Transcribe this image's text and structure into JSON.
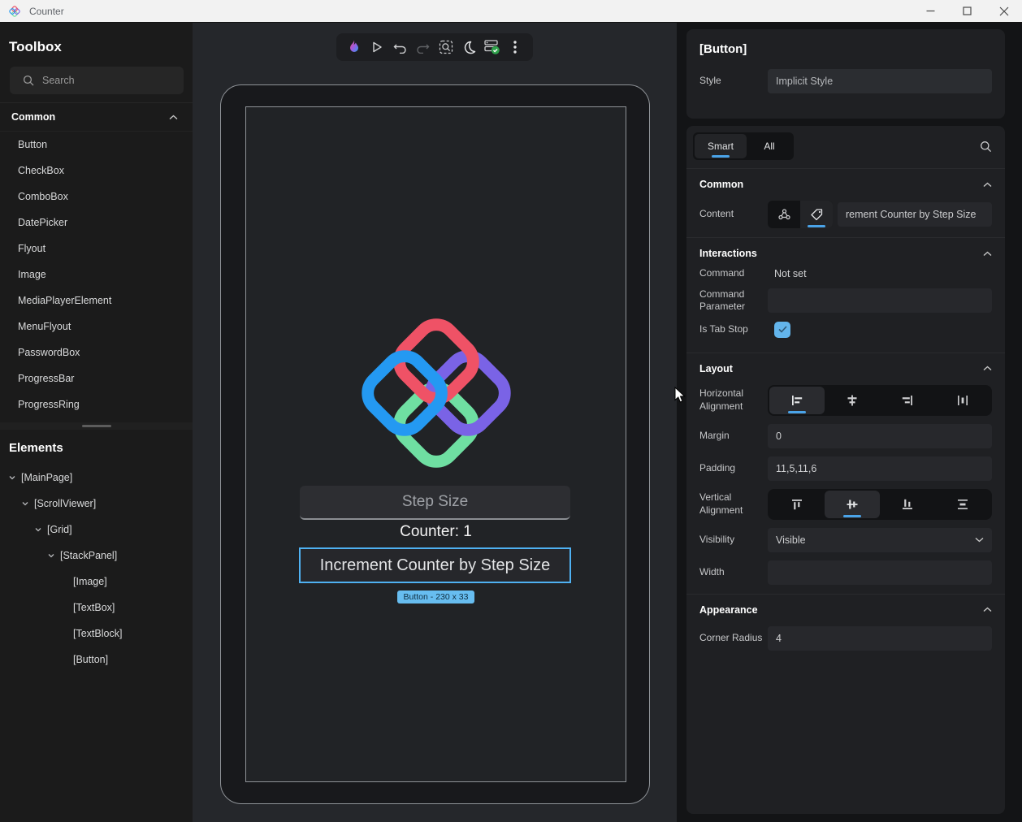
{
  "titlebar": {
    "title": "Counter"
  },
  "toolbox": {
    "title": "Toolbox",
    "search_placeholder": "Search",
    "section_label": "Common",
    "items": [
      "Button",
      "CheckBox",
      "ComboBox",
      "DatePicker",
      "Flyout",
      "Image",
      "MediaPlayerElement",
      "MenuFlyout",
      "PasswordBox",
      "ProgressBar",
      "ProgressRing"
    ]
  },
  "elements": {
    "title": "Elements",
    "tree": [
      {
        "label": "[MainPage]",
        "depth": 0,
        "expandable": true
      },
      {
        "label": "[ScrollViewer]",
        "depth": 1,
        "expandable": true
      },
      {
        "label": "[Grid]",
        "depth": 2,
        "expandable": true
      },
      {
        "label": "[StackPanel]",
        "depth": 3,
        "expandable": true
      },
      {
        "label": "[Image]",
        "depth": 4,
        "expandable": false
      },
      {
        "label": "[TextBox]",
        "depth": 4,
        "expandable": false
      },
      {
        "label": "[TextBlock]",
        "depth": 4,
        "expandable": false
      },
      {
        "label": "[Button]",
        "depth": 4,
        "expandable": false
      }
    ]
  },
  "toolbar_icons": [
    "hot-reload-flame",
    "play",
    "undo",
    "redo",
    "zoom-selection",
    "theme-moon",
    "status-check",
    "more-kebab"
  ],
  "canvas": {
    "textbox_placeholder": "Step Size",
    "counter_text": "Counter: 1",
    "button_label": "Increment Counter by Step Size",
    "selection_badge": "Button - 230 x 33"
  },
  "properties": {
    "header": "[Button]",
    "style_label": "Style",
    "style_value": "Implicit Style",
    "tabs": [
      {
        "label": "Smart",
        "active": true
      },
      {
        "label": "All",
        "active": false
      }
    ],
    "common": {
      "title": "Common",
      "content_label": "Content",
      "content_value": "rement Counter by Step Size"
    },
    "interactions": {
      "title": "Interactions",
      "command_label": "Command",
      "command_value": "Not set",
      "command_parameter_label": "Command Parameter",
      "command_parameter_value": "",
      "is_tab_stop_label": "Is Tab Stop",
      "is_tab_stop_checked": true
    },
    "layout": {
      "title": "Layout",
      "horizontal_alignment_label": "Horizontal Alignment",
      "margin_label": "Margin",
      "margin_value": "0",
      "padding_label": "Padding",
      "padding_value": "11,5,11,6",
      "vertical_alignment_label": "Vertical Alignment",
      "visibility_label": "Visibility",
      "visibility_value": "Visible",
      "width_label": "Width",
      "width_value": ""
    },
    "appearance": {
      "title": "Appearance",
      "corner_radius_label": "Corner Radius",
      "corner_radius_value": "4"
    }
  },
  "colors": {
    "accent_blue": "#4aa3e8",
    "selection_border": "#4fb1f2",
    "badge_bg": "#67bdf0",
    "logo_red": "#ef5266",
    "logo_blue": "#2499f2",
    "logo_purple": "#7a63e6",
    "logo_green": "#6fdfa2",
    "titlebar_bg": "#f2f2f2",
    "panel_bg": "#1b1b1b",
    "canvas_bg": "#25272b",
    "card_bg": "#1f2023",
    "status_green": "#2ea04a"
  }
}
